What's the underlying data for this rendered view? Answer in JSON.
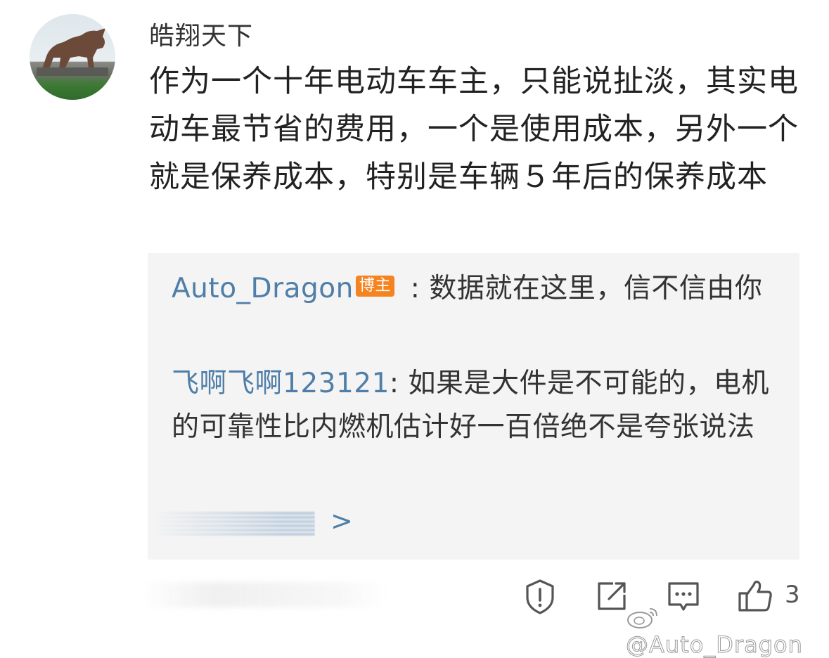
{
  "comment": {
    "username": "皓翔天下",
    "text": "作为一个十年电动车车主，只能说扯淡，其实电动车最节省的费用，一个是使用成本，另外一个就是保养成本，特别是车辆５年后的保养成本"
  },
  "replies": [
    {
      "name": "Auto_Dragon",
      "badge": "博主",
      "separator": " : ",
      "text": "数据就在这里，信不信由你"
    },
    {
      "name": "飞啊飞啊123121",
      "separator": ": ",
      "text": "如果是大件是不可能的，电机的可靠性比内燃机估计好一百倍绝不是夸张说法"
    }
  ],
  "more_replies": {
    "arrow": ">"
  },
  "actions": {
    "report_icon": "report-icon",
    "share_icon": "share-icon",
    "reply_icon": "comment-icon",
    "like_icon": "thumbs-up-icon",
    "like_count": "3"
  },
  "watermark": {
    "text": "@Auto_Dragon"
  },
  "colors": {
    "link_blue": "#4f7ea8",
    "badge_orange": "#f48320",
    "reply_bg": "#f4f4f4"
  }
}
